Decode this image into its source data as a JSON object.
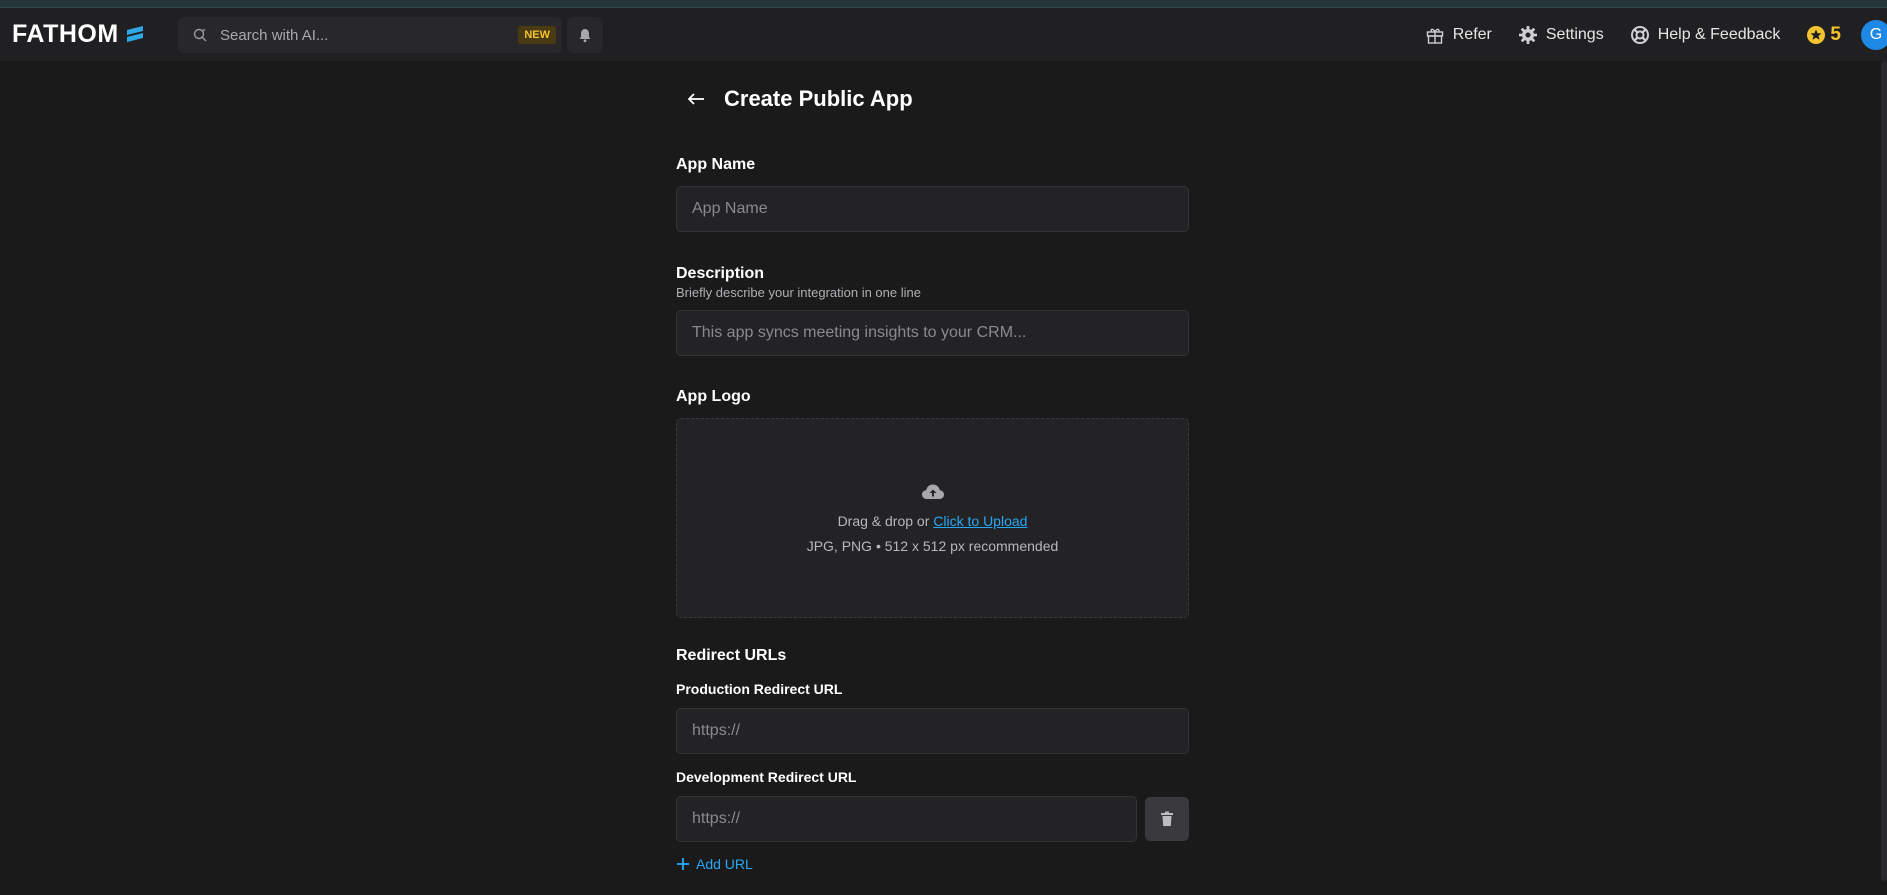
{
  "navbar": {
    "logo_text": "FATHOM",
    "search_placeholder": "Search with AI...",
    "search_badge": "NEW",
    "refer_label": "Refer",
    "settings_label": "Settings",
    "help_label": "Help & Feedback",
    "credits_count": "5",
    "avatar_initial": "G"
  },
  "page": {
    "title": "Create Public App"
  },
  "form": {
    "app_name": {
      "label": "App Name",
      "placeholder": "App Name"
    },
    "description": {
      "label": "Description",
      "helper": "Briefly describe your integration in one line",
      "placeholder": "This app syncs meeting insights to your CRM..."
    },
    "app_logo": {
      "label": "App Logo",
      "drag_text": "Drag & drop or",
      "upload_link": "Click to Upload",
      "hint": "JPG, PNG • 512 x 512 px recommended"
    },
    "redirect_urls": {
      "label": "Redirect URLs",
      "production": {
        "label": "Production Redirect URL",
        "placeholder": "https://"
      },
      "development": {
        "label": "Development Redirect URL",
        "placeholder": "https://"
      },
      "add_url_label": "Add URL"
    }
  },
  "icons": {
    "logo_mark": "fathom-logo-icon",
    "search": "ai-search-icon",
    "bell": "bell-icon",
    "refer": "gift-icon",
    "settings": "gear-icon",
    "help": "lifebuoy-icon",
    "credits": "star-coin-icon",
    "back": "arrow-left-icon",
    "upload": "cloud-upload-icon",
    "trash": "trash-icon",
    "add": "plus-icon"
  },
  "colors": {
    "background": "#1a1a1b",
    "navbar": "#202022",
    "input_bg": "#232326",
    "accent_link": "#29a8f5",
    "badge_text": "#f4c430",
    "avatar": "#1e88e5"
  }
}
